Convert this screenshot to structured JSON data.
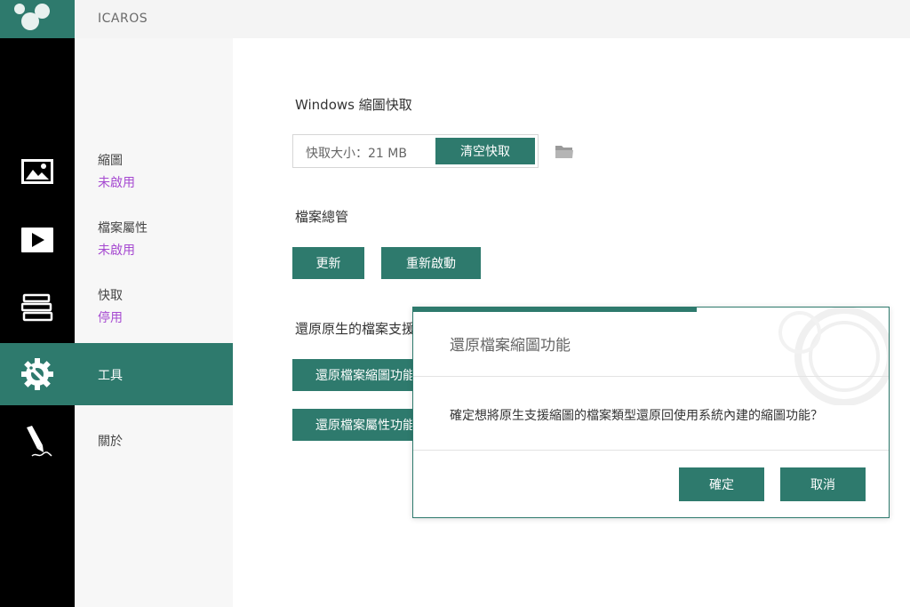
{
  "app": {
    "title": "ICAROS"
  },
  "sidebar": {
    "items": [
      {
        "icon": "image-icon",
        "label": "縮圖",
        "status": "未啟用"
      },
      {
        "icon": "video-play-icon",
        "label": "檔案屬性",
        "status": "未啟用"
      },
      {
        "icon": "stack-books-icon",
        "label": "快取",
        "status": "停用"
      },
      {
        "icon": "gear-wrench-icon",
        "label": "工具",
        "status": ""
      },
      {
        "icon": "pen-signature-icon",
        "label": "關於",
        "status": ""
      }
    ],
    "active_index": 3
  },
  "main": {
    "cache": {
      "title": "Windows 縮圖快取",
      "size_text": "快取大小：21 MB",
      "clear_label": "清空快取",
      "folder_icon": "folder-icon"
    },
    "explorer": {
      "title": "檔案總管",
      "refresh_label": "更新",
      "restart_label": "重新啟動"
    },
    "restore": {
      "title": "還原原生的檔案支援",
      "restore_thumbnails_label": "還原檔案縮圖功能",
      "restore_properties_label": "還原檔案屬性功能"
    }
  },
  "dialog": {
    "title": "還原檔案縮圖功能",
    "message": "確定想將原生支援縮圖的檔案類型還原回使用系統內建的縮圖功能？",
    "ok_label": "確定",
    "cancel_label": "取消"
  },
  "colors": {
    "accent": "#2e7a6d",
    "rail": "#000000",
    "status": "#a64ad1"
  }
}
